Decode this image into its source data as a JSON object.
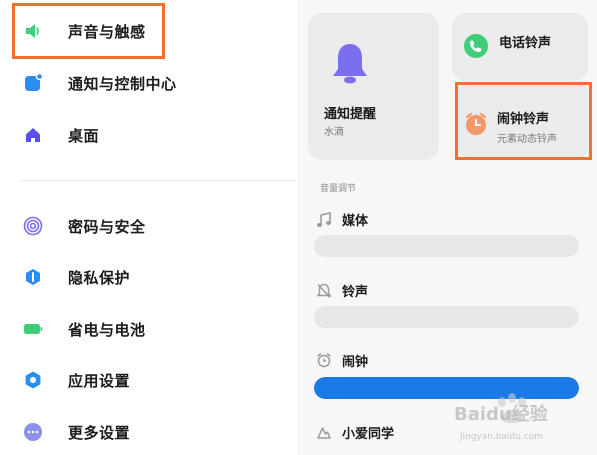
{
  "settings_list": {
    "items": [
      {
        "label": "声音与触感",
        "icon": "speaker-icon",
        "color": "#3fcd7a"
      },
      {
        "label": "通知与控制中心",
        "icon": "notification-icon",
        "color": "#2b8df0"
      },
      {
        "label": "桌面",
        "icon": "home-icon",
        "color": "#5b4ff0"
      },
      {
        "label": "密码与安全",
        "icon": "fingerprint-icon",
        "color": "#7b6ff0"
      },
      {
        "label": "隐私保护",
        "icon": "privacy-shield-icon",
        "color": "#2b8df0"
      },
      {
        "label": "省电与电池",
        "icon": "battery-icon",
        "color": "#3fcd7a"
      },
      {
        "label": "应用设置",
        "icon": "gear-icon",
        "color": "#2b8df0"
      },
      {
        "label": "更多设置",
        "icon": "more-dots-icon",
        "color": "#8a8ff0"
      }
    ]
  },
  "sound_panel": {
    "notification_card": {
      "title": "通知提醒",
      "subtitle": "水滴",
      "icon": "bell-icon",
      "color": "#7b6ff0"
    },
    "phone_ringtone_card": {
      "title": "电话铃声",
      "icon": "phone-icon",
      "color": "#3fcd7a"
    },
    "alarm_ringtone_card": {
      "title": "闹钟铃声",
      "subtitle": "元素动态铃声",
      "icon": "alarm-clock-icon",
      "color": "#f4976a"
    },
    "volume_section_label": "音量调节",
    "volume_rows": [
      {
        "label": "媒体",
        "icon": "music-note-icon",
        "level": 0.0
      },
      {
        "label": "铃声",
        "icon": "bell-muted-icon",
        "level": 0.0
      },
      {
        "label": "闹钟",
        "icon": "alarm-icon",
        "level": 1.0
      },
      {
        "label": "小爱同学",
        "icon": "xiaoai-icon"
      }
    ]
  },
  "highlight_color": "#f07030",
  "watermark": {
    "brand": "Baidu经验",
    "url": "jingyan.baidu.com"
  }
}
